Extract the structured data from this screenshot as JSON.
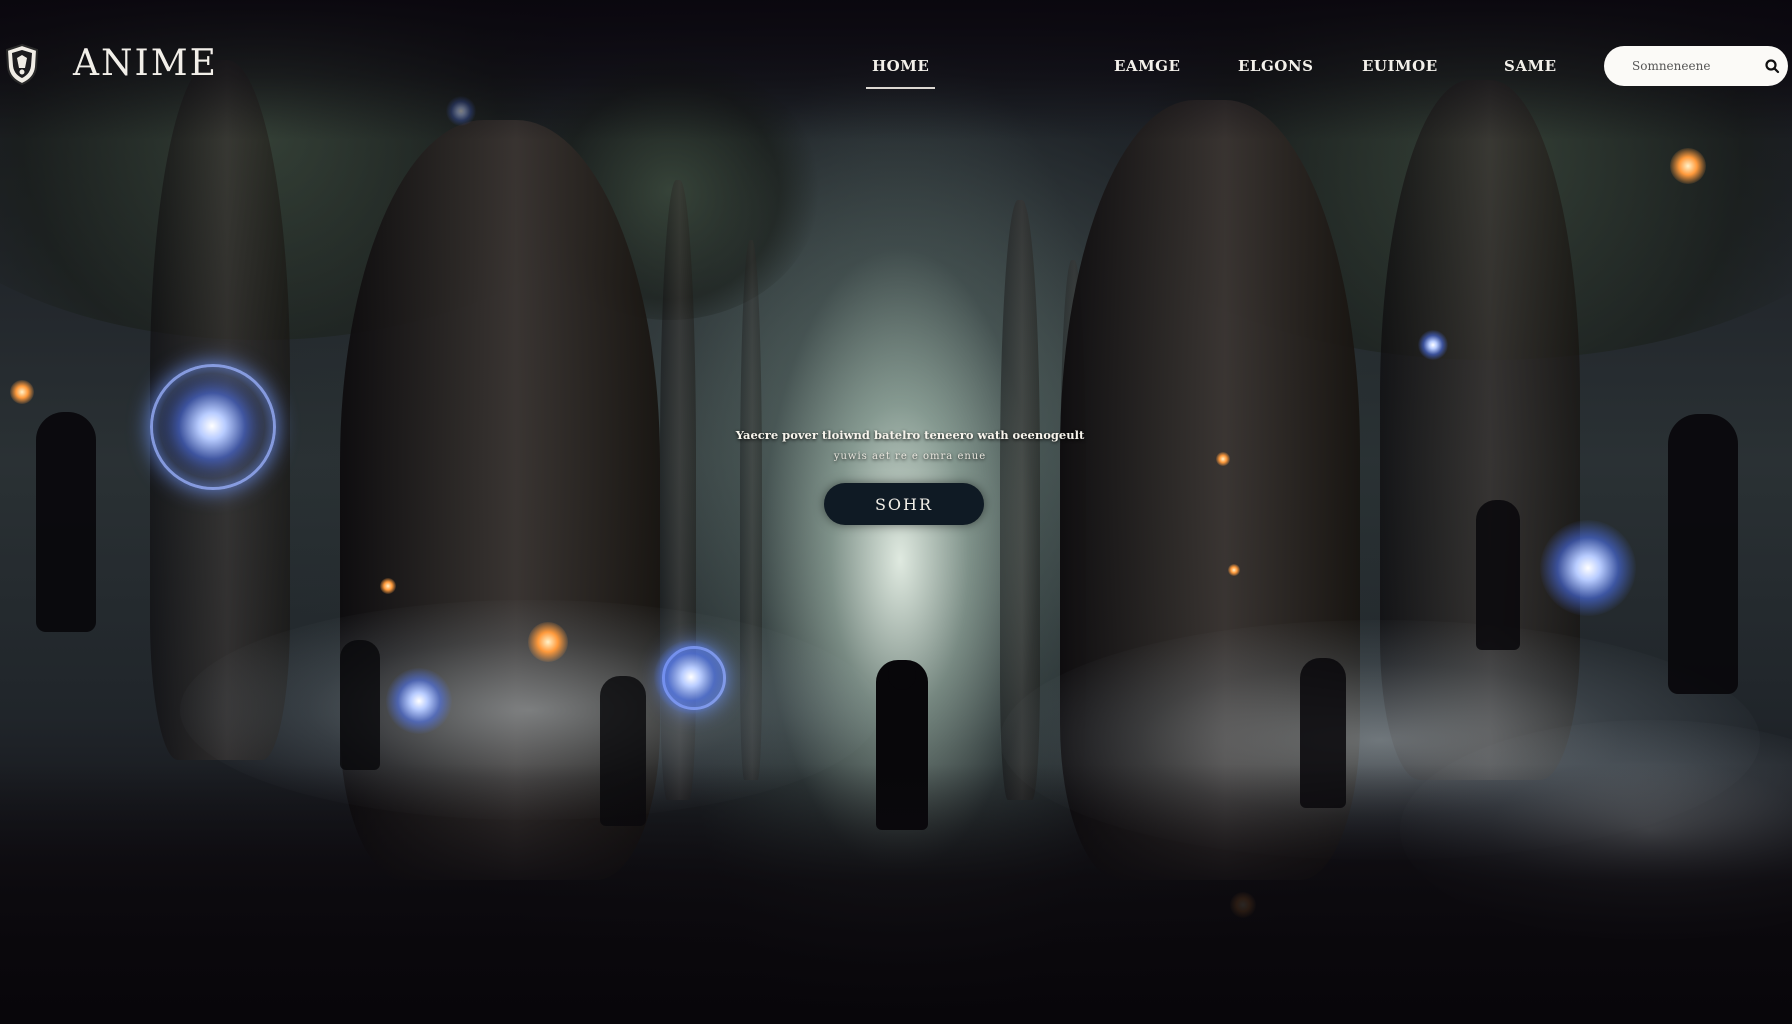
{
  "brand": {
    "name": "ANIME",
    "logo_icon": "shield-crest-icon"
  },
  "nav": {
    "items": [
      {
        "label": "HOME",
        "active": true
      },
      {
        "label": "EAMGE",
        "active": false
      },
      {
        "label": "ELGONS",
        "active": false
      },
      {
        "label": "EUIMOE",
        "active": false
      },
      {
        "label": "SAME",
        "active": false
      }
    ]
  },
  "search": {
    "placeholder": "Somneneene",
    "icon": "search-icon"
  },
  "hero": {
    "line1": "Yaecre pover tloiwnd batelro teneero wath oeenogeult",
    "line2": "yuwis aet re e omra enue",
    "button_label": "SOHR"
  },
  "colors": {
    "nav_text": "#f3f0ea",
    "search_bg": "#fbfaf7",
    "button_bg": "#0f1a24",
    "orb_glow": "#8fa8ff"
  }
}
